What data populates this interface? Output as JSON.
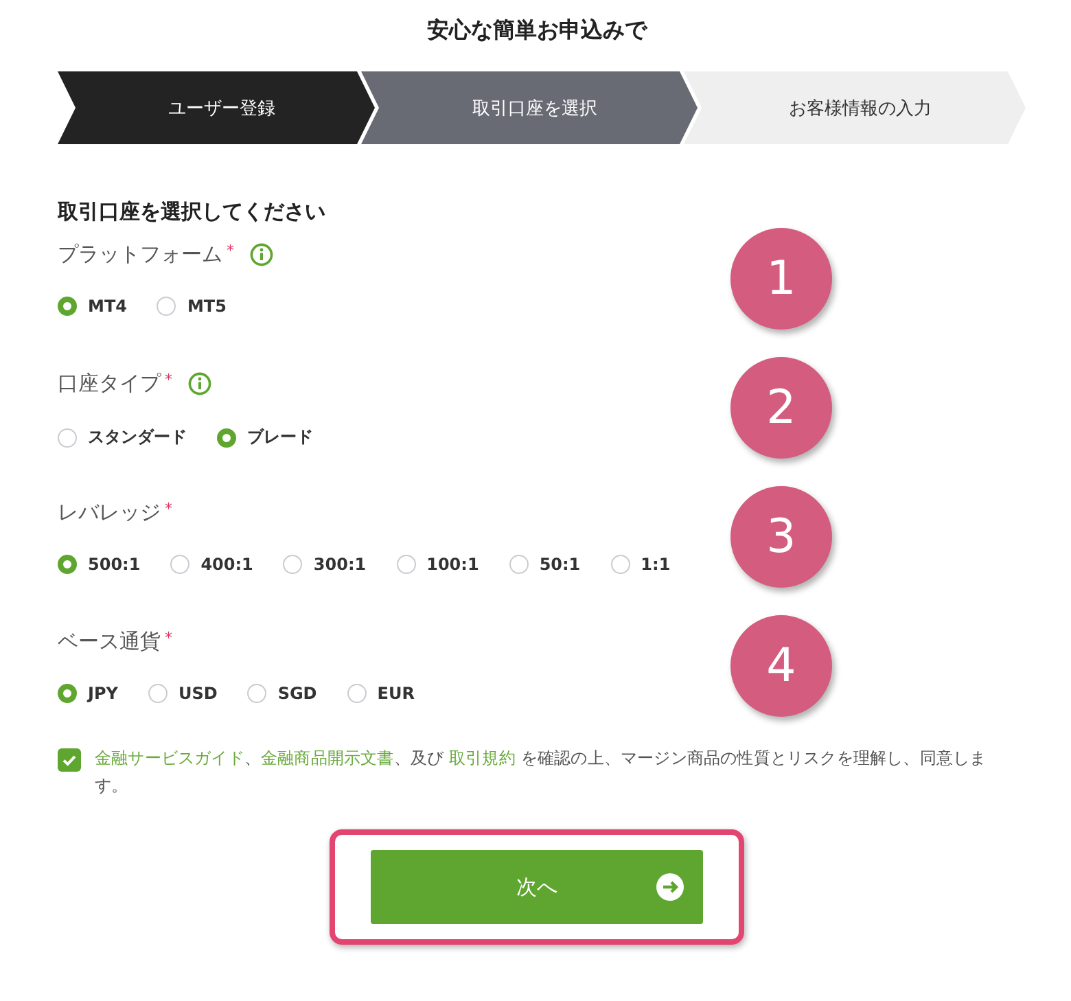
{
  "title": "安心な簡単お申込みで",
  "steps": [
    {
      "label": "ユーザー登録",
      "done": true,
      "selected": false
    },
    {
      "label": "取引口座を選択",
      "done": false,
      "selected": true
    },
    {
      "label": "お客様情報の入力",
      "done": false,
      "selected": false
    }
  ],
  "heading": "取引口座を選択してください",
  "groups": [
    {
      "label": "プラットフォーム",
      "required_mark": "*",
      "info": true,
      "badge": "1",
      "options": [
        {
          "label": "MT4",
          "selected": true
        },
        {
          "label": "MT5",
          "selected": false
        }
      ]
    },
    {
      "label": "口座タイプ",
      "required_mark": "*",
      "info": true,
      "badge": "2",
      "options": [
        {
          "label": "スタンダード",
          "selected": false
        },
        {
          "label": "ブレード",
          "selected": true
        }
      ]
    },
    {
      "label": "レバレッジ",
      "required_mark": "*",
      "info": false,
      "badge": "3",
      "options": [
        {
          "label": "500:1",
          "selected": true
        },
        {
          "label": "400:1",
          "selected": false
        },
        {
          "label": "300:1",
          "selected": false
        },
        {
          "label": "100:1",
          "selected": false
        },
        {
          "label": "50:1",
          "selected": false
        },
        {
          "label": "1:1",
          "selected": false
        }
      ]
    },
    {
      "label": "ベース通貨",
      "required_mark": "*",
      "info": false,
      "badge": "4",
      "options": [
        {
          "label": "JPY",
          "selected": true
        },
        {
          "label": "USD",
          "selected": false
        },
        {
          "label": "SGD",
          "selected": false
        },
        {
          "label": "EUR",
          "selected": false
        }
      ]
    }
  ],
  "agreement": {
    "checked": true,
    "parts": [
      {
        "kind": "link",
        "text": "金融サービスガイド"
      },
      {
        "kind": "text",
        "text": "、"
      },
      {
        "kind": "link",
        "text": "金融商品開示文書"
      },
      {
        "kind": "text",
        "text": "、及び "
      },
      {
        "kind": "link",
        "text": "取引規約"
      },
      {
        "kind": "text",
        "text": " を確認の上、マージン商品の性質とリスクを理解し、同意します。"
      }
    ]
  },
  "next_button": {
    "label": "次へ",
    "highlighted": true
  }
}
